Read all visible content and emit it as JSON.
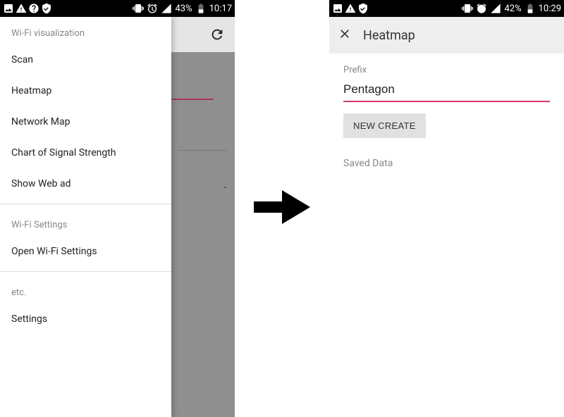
{
  "left": {
    "status": {
      "battery": "43%",
      "time": "10:17"
    },
    "drawer": {
      "section1": {
        "header": "Wi-Fi visualization",
        "items": [
          "Scan",
          "Heatmap",
          "Network Map",
          "Chart of Signal Strength",
          "Show Web ad"
        ]
      },
      "section2": {
        "header": "Wi-Fi Settings",
        "items": [
          "Open Wi-Fi Settings"
        ]
      },
      "section3": {
        "header": "etc.",
        "items": [
          "Settings"
        ]
      }
    }
  },
  "right": {
    "status": {
      "battery": "42%",
      "time": "10:29"
    },
    "toolbar": {
      "title": "Heatmap"
    },
    "form": {
      "prefix_label": "Prefix",
      "prefix_value": "Pentagon",
      "create_button": "NEW CREATE",
      "saved_data_label": "Saved Data"
    }
  }
}
